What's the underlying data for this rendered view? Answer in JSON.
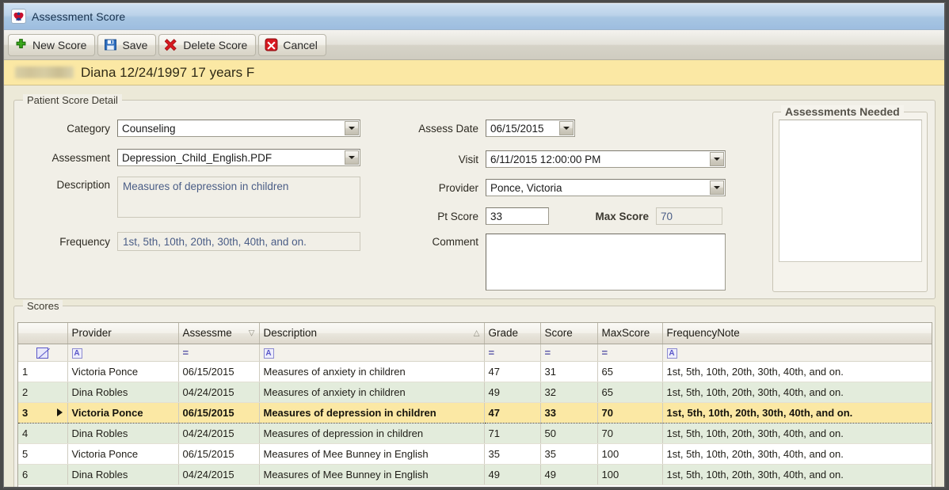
{
  "window": {
    "title": "Assessment Score",
    "title_icon": "heart-family-logo-icon"
  },
  "toolbar": {
    "buttons": [
      {
        "label": "New Score",
        "icon": "plus-green-icon"
      },
      {
        "label": "Save",
        "icon": "floppy-disk-icon"
      },
      {
        "label": "Delete Score",
        "icon": "red-x-icon"
      },
      {
        "label": "Cancel",
        "icon": "red-x-box-icon"
      }
    ]
  },
  "patient_banner": {
    "last_name_redacted": "",
    "text": "Diana 12/24/1997 17 years F"
  },
  "detail": {
    "group_title": "Patient Score Detail",
    "category": {
      "label": "Category",
      "value": "Counseling"
    },
    "assessment": {
      "label": "Assessment",
      "value": "Depression_Child_English.PDF"
    },
    "description": {
      "label": "Description",
      "value": "Measures of depression in children"
    },
    "frequency": {
      "label": "Frequency",
      "value": "1st, 5th, 10th, 20th, 30th, 40th, and on."
    },
    "assess_date": {
      "label": "Assess Date",
      "value": "06/15/2015"
    },
    "visit": {
      "label": "Visit",
      "value": "6/11/2015 12:00:00 PM"
    },
    "provider": {
      "label": "Provider",
      "value": "Ponce, Victoria"
    },
    "pt_score": {
      "label": "Pt Score",
      "value": "33"
    },
    "max_score": {
      "label": "Max Score",
      "value": "70"
    },
    "comment": {
      "label": "Comment",
      "value": ""
    }
  },
  "assessments_needed": {
    "group_title": "Assessments Needed",
    "items": []
  },
  "scores": {
    "group_title": "Scores",
    "columns": [
      {
        "key": "rownum",
        "label": "",
        "sort": "",
        "filter": "cross"
      },
      {
        "key": "provider",
        "label": "Provider",
        "sort": "",
        "filter": "A"
      },
      {
        "key": "assessme",
        "label": "Assessme",
        "sort": "desc",
        "filter": "eq"
      },
      {
        "key": "description",
        "label": "Description",
        "sort": "asc",
        "filter": "A"
      },
      {
        "key": "grade",
        "label": "Grade",
        "sort": "",
        "filter": "eq"
      },
      {
        "key": "score",
        "label": "Score",
        "sort": "",
        "filter": "eq"
      },
      {
        "key": "maxscore",
        "label": "MaxScore",
        "sort": "",
        "filter": "eq"
      },
      {
        "key": "frequencynote",
        "label": "FrequencyNote",
        "sort": "",
        "filter": "A"
      }
    ],
    "rows": [
      {
        "rownum": "1",
        "provider": "Victoria Ponce",
        "assessme": "06/15/2015",
        "description": "Measures of anxiety in children",
        "grade": "47",
        "score": "31",
        "maxscore": "65",
        "frequencynote": "1st, 5th, 10th, 20th, 30th, 40th, and on.",
        "selected": false
      },
      {
        "rownum": "2",
        "provider": "Dina Robles",
        "assessme": "04/24/2015",
        "description": "Measures of anxiety in children",
        "grade": "49",
        "score": "32",
        "maxscore": "65",
        "frequencynote": "1st, 5th, 10th, 20th, 30th, 40th, and on.",
        "selected": false
      },
      {
        "rownum": "3",
        "provider": "Victoria Ponce",
        "assessme": "06/15/2015",
        "description": "Measures of depression in children",
        "grade": "47",
        "score": "33",
        "maxscore": "70",
        "frequencynote": "1st, 5th, 10th, 20th, 30th, 40th, and on.",
        "selected": true
      },
      {
        "rownum": "4",
        "provider": "Dina Robles",
        "assessme": "04/24/2015",
        "description": "Measures of depression in children",
        "grade": "71",
        "score": "50",
        "maxscore": "70",
        "frequencynote": "1st, 5th, 10th, 20th, 30th, 40th, and on.",
        "selected": false
      },
      {
        "rownum": "5",
        "provider": "Victoria Ponce",
        "assessme": "06/15/2015",
        "description": "Measures of Mee Bunney in English",
        "grade": "35",
        "score": "35",
        "maxscore": "100",
        "frequencynote": "1st, 5th, 10th, 20th, 30th, 40th, and on.",
        "selected": false
      },
      {
        "rownum": "6",
        "provider": "Dina Robles",
        "assessme": "04/24/2015",
        "description": "Measures of Mee Bunney in English",
        "grade": "49",
        "score": "49",
        "maxscore": "100",
        "frequencynote": "1st, 5th, 10th, 20th, 30th, 40th, and on.",
        "selected": false
      }
    ]
  },
  "colors": {
    "titlebar": "#a8c6e2",
    "banner": "#fbe8a4",
    "selected_row": "#fbe8a4",
    "alt_row": "#e3ecdc",
    "readonly_text": "#4a5d86"
  }
}
